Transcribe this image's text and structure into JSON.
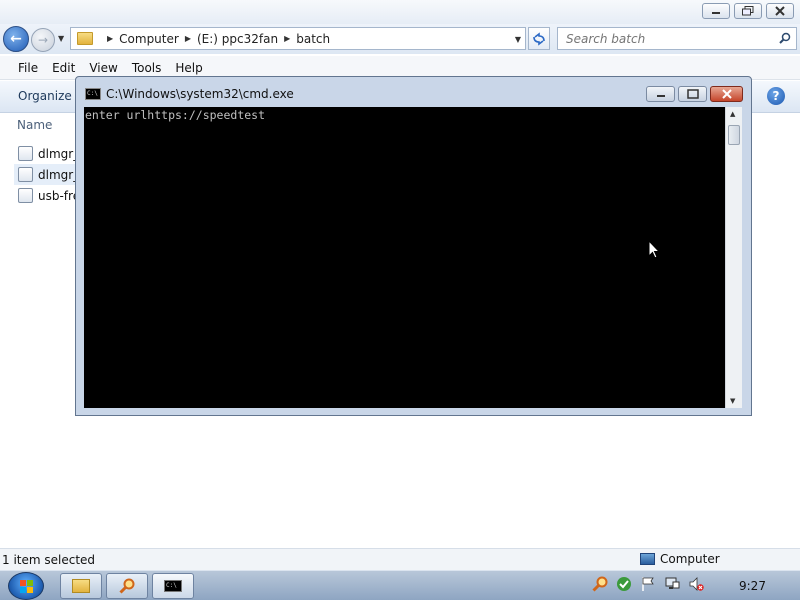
{
  "explorer": {
    "address": {
      "crumbs": [
        "Computer",
        "(E:) ppc32fan",
        "batch"
      ]
    },
    "search": {
      "placeholder": "Search batch"
    },
    "menu": [
      "File",
      "Edit",
      "View",
      "Tools",
      "Help"
    ],
    "toolbar": {
      "organize_label": "Organize ▾"
    },
    "columns": {
      "name": "Name"
    },
    "files": [
      {
        "label": "dlmgr_"
      },
      {
        "label": "dlmgr_"
      },
      {
        "label": "usb-fre"
      }
    ],
    "status": {
      "left": "1 item selected",
      "right": "Computer"
    }
  },
  "cmd": {
    "title": "C:\\Windows\\system32\\cmd.exe",
    "console_text": "enter urlhttps://speedtest"
  },
  "taskbar": {
    "clock": "9:27"
  },
  "icons": {
    "explorer_minimize": "minimize-icon",
    "explorer_maximize": "restore-icon",
    "explorer_close": "close-icon",
    "cmd_icon": "C:\\"
  }
}
